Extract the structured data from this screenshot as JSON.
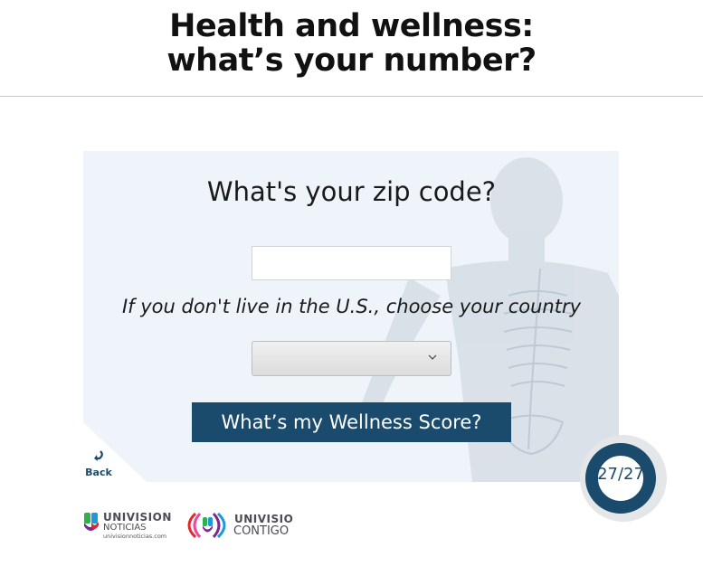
{
  "page": {
    "title_line1": "Health and wellness:",
    "title_line2": "what’s your number?"
  },
  "form": {
    "question": "What's your zip code?",
    "zip_value": "",
    "country_label": "If you don't live in the U.S., choose your country",
    "country_selected": "",
    "submit_label": "What’s my Wellness Score?"
  },
  "nav": {
    "back_label": "Back"
  },
  "progress": {
    "text": "27/27",
    "current": 27,
    "total": 27,
    "ring_color": "#1b4b6c"
  },
  "footer": {
    "logo1_word1": "UNIVISION",
    "logo1_word2": "NOTICIAS",
    "logo1_url": "univisionnoticias.com",
    "logo2_word1": "UNIVISION",
    "logo2_word2": "CONTIGO"
  },
  "colors": {
    "accent": "#1b4b6c",
    "card_bg": "#eef4fa"
  }
}
